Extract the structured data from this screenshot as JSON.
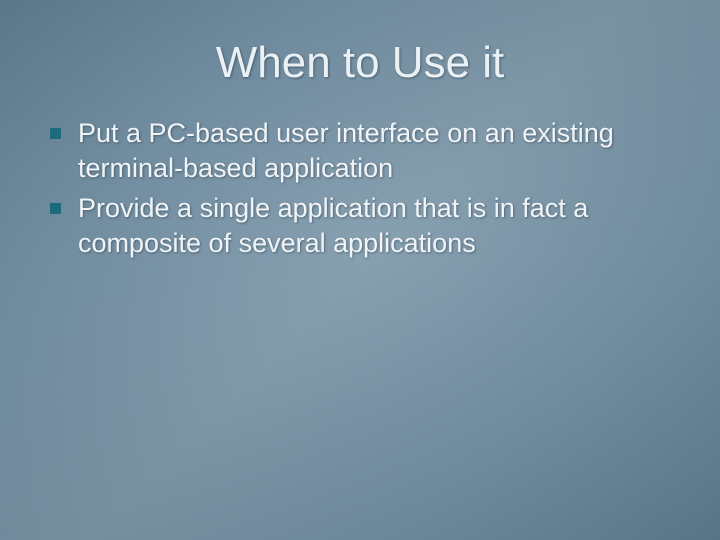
{
  "slide": {
    "title": "When to Use it",
    "bullets": [
      "Put a PC-based user interface on an existing terminal-based application",
      "Provide a single application that is in fact a composite of several applications"
    ]
  }
}
